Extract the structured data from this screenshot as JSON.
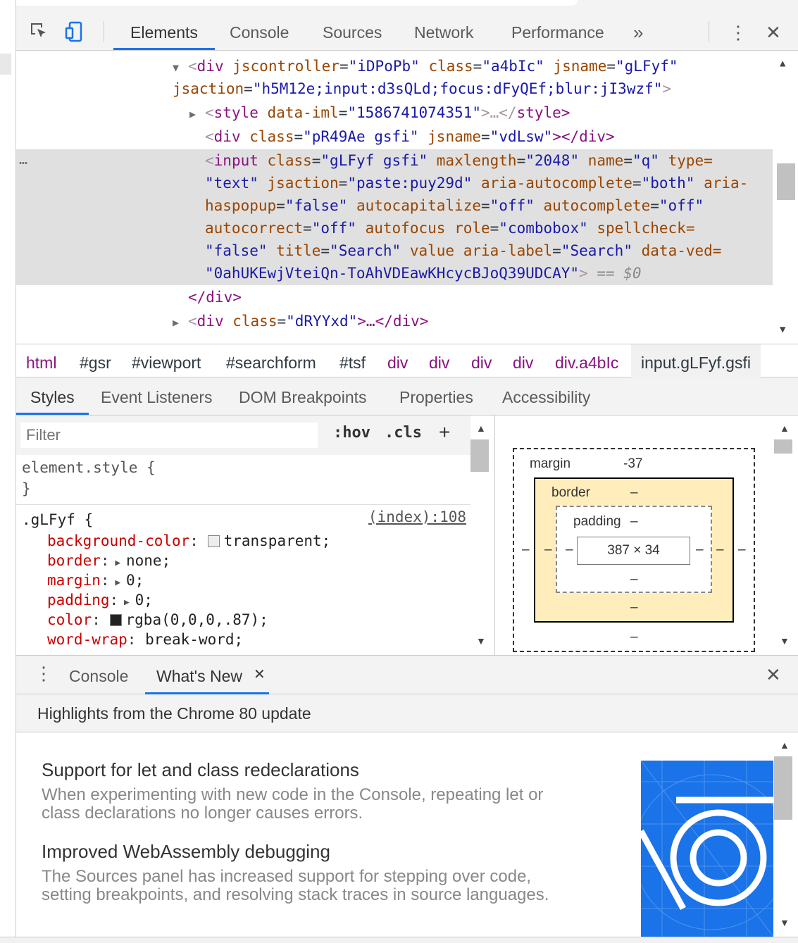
{
  "toolbar": {
    "tabs": [
      "Elements",
      "Console",
      "Sources",
      "Network",
      "Performance"
    ],
    "more": "»",
    "menu": "⋮",
    "close": "✕"
  },
  "tree": {
    "l1": {
      "open": "<",
      "tag": "div",
      "a1": "jscontroller",
      "v1": "\"iDPoPb\"",
      "a2": "class",
      "v2": "\"a4bIc\"",
      "a3": "jsname",
      "v3": "\"gLFyf\""
    },
    "l2": {
      "a1": "jsaction",
      "v1": "\"h5M12e;input:d3sQLd;focus:dFyQEf;blur:jI3wzf\"",
      "close": ">"
    },
    "l3": {
      "tag": "style",
      "a1": "data-iml",
      "v1": "\"1586741074351\"",
      "mid": ">…</",
      "end": "style>"
    },
    "l4": {
      "tag": "div",
      "a1": "class",
      "v1": "\"pR49Ae gsfi\"",
      "a2": "jsname",
      "v2": "\"vdLsw\"",
      "end": "></div>"
    },
    "l5": {
      "tag": "input",
      "a1": "class",
      "v1": "\"gLFyf gsfi\"",
      "a2": "maxlength",
      "v2": "\"2048\"",
      "a3": "name",
      "v3": "\"q\"",
      "a4": "type="
    },
    "l6": {
      "v0": "\"text\"",
      "a1": "jsaction",
      "v1": "\"paste:puy29d\"",
      "a2": "aria-autocomplete",
      "v2": "\"both\"",
      "a3": "aria-"
    },
    "l7": {
      "a0": "haspopup",
      "v0": "\"false\"",
      "a1": "autocapitalize",
      "v1": "\"off\"",
      "a2": "autocomplete",
      "v2": "\"off\""
    },
    "l8": {
      "a0": "autocorrect",
      "v0": "\"off\"",
      "a1": "autofocus",
      "a2": "role",
      "v2": "\"combobox\"",
      "a3": "spellcheck="
    },
    "l9": {
      "v0": "\"false\"",
      "a1": "title",
      "v1": "\"Search\"",
      "a2": "value",
      "a3": "aria-label",
      "v3": "\"Search\"",
      "a4": "data-ved="
    },
    "l10": {
      "v0": "\"0ahUKEwjVteiQn-ToAhVDEawKHcycBJoQ39UDCAY\"",
      "close": ">",
      "eq": " == ",
      "dollar": "$0"
    },
    "l11": {
      "close": "</div>"
    },
    "l12": {
      "tag": "div",
      "a1": "class",
      "v1": "\"dRYYxd\"",
      "end": ">…</div>"
    },
    "ellipsis": "…"
  },
  "breadcrumb": [
    "html",
    "#gsr",
    "#viewport",
    "#searchform",
    "#tsf",
    "div",
    "div",
    "div",
    "div",
    "div.a4bIc",
    "input.gLFyf.gsfi"
  ],
  "styles_tabs": [
    "Styles",
    "Event Listeners",
    "DOM Breakpoints",
    "Properties",
    "Accessibility"
  ],
  "styles": {
    "filter_placeholder": "Filter",
    "hov": ":hov",
    "cls": ".cls",
    "plus": "+",
    "element_style_open": "element.style {",
    "element_style_close": "}",
    "rule_selector": ".gLFyf {",
    "rule_source": "(index):108",
    "props": [
      {
        "name": "background-color",
        "value": "transparent;",
        "swatch": "#eeeeee"
      },
      {
        "name": "border",
        "value": "none;"
      },
      {
        "name": "margin",
        "value": "0;"
      },
      {
        "name": "padding",
        "value": "0;"
      },
      {
        "name": "color",
        "value": "rgba(0,0,0,.87);",
        "swatch": "#222222"
      },
      {
        "name": "word-wrap",
        "value": "break-word;"
      }
    ]
  },
  "box_model": {
    "margin_label": "margin",
    "margin_top": "-37",
    "border_label": "border",
    "padding_label": "padding",
    "dash": "–",
    "content": "387 × 34"
  },
  "drawer": {
    "tabs": [
      "Console",
      "What's New"
    ],
    "close_tab": "✕",
    "close": "✕",
    "subheader": "Highlights from the Chrome 80 update",
    "items": [
      {
        "title": "Support for let and class redeclarations",
        "desc": "When experimenting with new code in the Console, repeating let or class declarations no longer causes errors."
      },
      {
        "title": "Improved WebAssembly debugging",
        "desc": "The Sources panel has increased support for stepping over code, setting breakpoints, and resolving stack traces in source languages."
      }
    ]
  },
  "colors": {
    "accent": "#1a73e8",
    "tag": "#881280",
    "attr": "#994500",
    "value": "#1a1aa6",
    "prop": "#c80000",
    "border_box": "#ffeebc"
  }
}
